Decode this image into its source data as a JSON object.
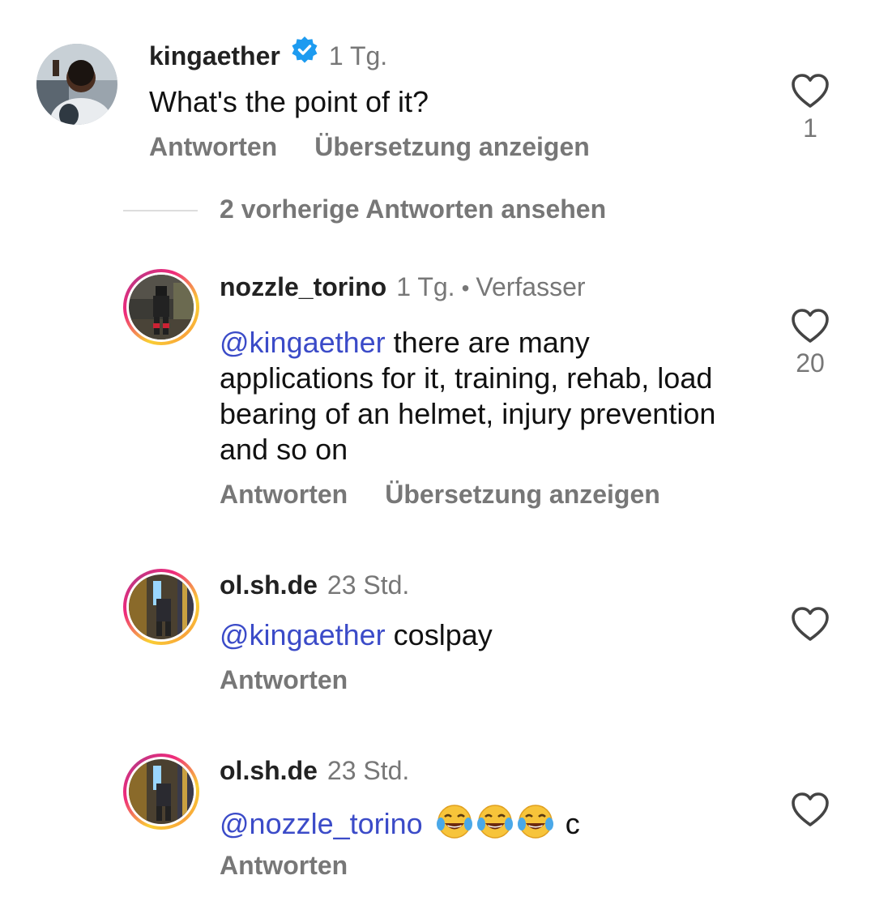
{
  "comments": [
    {
      "username": "kingaether",
      "time": "1 Tg.",
      "text": "What's the point of it?",
      "reply_label": "Antworten",
      "translate_label": "Übersetzung anzeigen",
      "likes": "1"
    },
    {
      "username": "nozzle_torino",
      "time": "1 Tg.",
      "author_label": "Verfasser",
      "mention": "@kingaether",
      "text": " there are many applications for it, training, rehab, load bearing of an helmet, injury prevention and so on",
      "reply_label": "Antworten",
      "translate_label": "Übersetzung anzeigen",
      "likes": "20"
    },
    {
      "username": "ol.sh.de",
      "time": "23 Std.",
      "mention": "@kingaether",
      "text": " coslpay",
      "reply_label": "Antworten"
    },
    {
      "username": "ol.sh.de",
      "time": "23 Std.",
      "mention": "@nozzle_torino",
      "text": " c",
      "emojis": [
        "face-with-tears-of-joy",
        "face-with-tears-of-joy",
        "face-with-tears-of-joy"
      ],
      "reply_label": "Antworten"
    }
  ],
  "view_more_label": "2 vorherige Antworten ansehen",
  "colors": {
    "mention": "#3b4bc8",
    "verified": "#1d9bf0",
    "secondary_text": "#777777"
  },
  "icons": {
    "like": "heart-outline-icon",
    "verified": "verified-badge-icon"
  }
}
